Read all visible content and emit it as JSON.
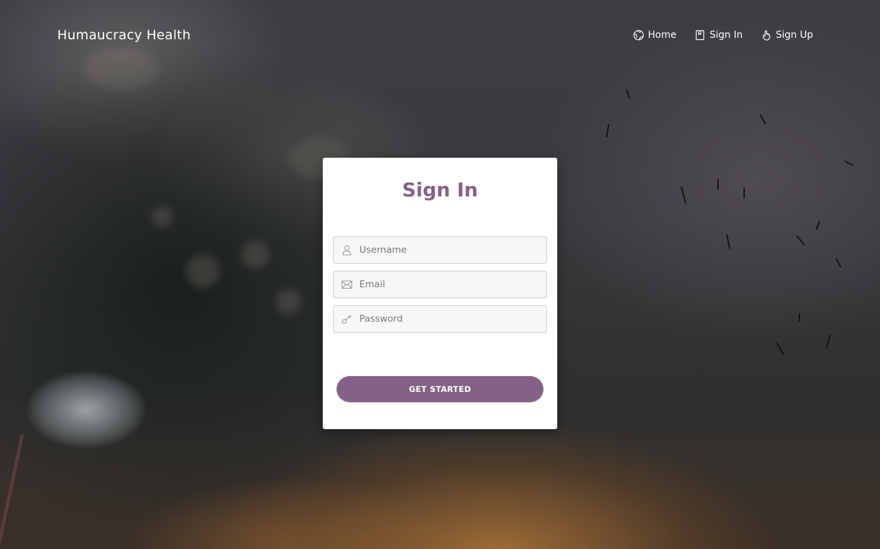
{
  "navbar": {
    "brand": "Humaucracy Health",
    "links": [
      {
        "label": "Home",
        "icon": "globe-icon"
      },
      {
        "label": "Sign In",
        "icon": "book-icon"
      },
      {
        "label": "Sign Up",
        "icon": "hand-pointer-icon"
      }
    ]
  },
  "signin": {
    "title": "Sign In",
    "fields": [
      {
        "placeholder": "Username",
        "icon": "user-icon",
        "value": ""
      },
      {
        "placeholder": "Email",
        "icon": "envelope-icon",
        "value": ""
      },
      {
        "placeholder": "Password",
        "icon": "key-icon",
        "value": ""
      }
    ],
    "submit_label": "GET STARTED"
  },
  "colors": {
    "accent": "#856185",
    "card_background": "#ffffff",
    "nav_text": "#ffffff"
  }
}
